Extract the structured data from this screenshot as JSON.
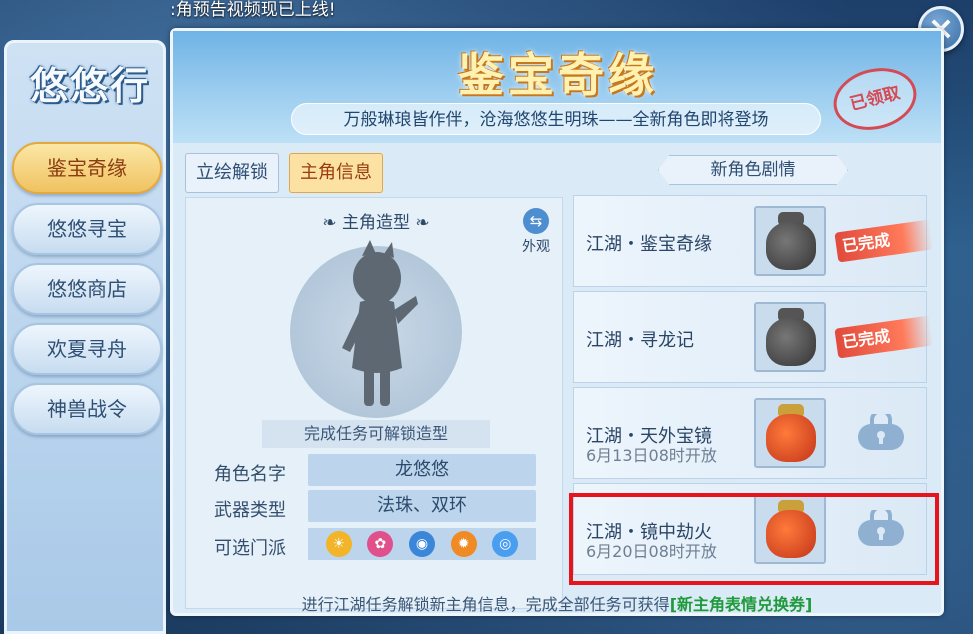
{
  "marquee": ":角预告视频现已上线!",
  "sidebar": {
    "title": "悠悠行",
    "items": [
      {
        "label": "鉴宝奇缘",
        "active": true
      },
      {
        "label": "悠悠寻宝",
        "active": false
      },
      {
        "label": "悠悠商店",
        "active": false
      },
      {
        "label": "欢夏寻舟",
        "active": false
      },
      {
        "label": "神兽战令",
        "active": false
      }
    ]
  },
  "banner": {
    "title": "鉴宝奇缘",
    "subtitle": "万般琳琅皆作伴，沧海悠悠生明珠——全新角色即将登场",
    "stamp": "已领取"
  },
  "tabs": [
    {
      "label": "立绘解锁",
      "active": false
    },
    {
      "label": "主角信息",
      "active": true
    }
  ],
  "character": {
    "heading": "主角造型",
    "outfit_label": "外观",
    "unlock_hint": "完成任务可解锁造型",
    "name_label": "角色名字",
    "name_value": "龙悠悠",
    "weapon_label": "武器类型",
    "weapon_value": "法珠、双环",
    "sect_label": "可选门派"
  },
  "story": {
    "header": "新角色剧情",
    "quests": [
      {
        "name": "江湖・鉴宝奇缘",
        "date": "",
        "status": "done",
        "status_label": "已完成",
        "bag": "gray"
      },
      {
        "name": "江湖・寻龙记",
        "date": "",
        "status": "done",
        "status_label": "已完成",
        "bag": "gray"
      },
      {
        "name": "江湖・天外宝镜",
        "date": "6月13日08时开放",
        "status": "locked",
        "status_label": "",
        "bag": "red"
      },
      {
        "name": "江湖・镜中劫火",
        "date": "6月20日08时开放",
        "status": "locked",
        "status_label": "",
        "bag": "red"
      }
    ]
  },
  "footer": {
    "text": "进行江湖任务解锁新主角信息，完成全部任务可获得",
    "highlight": "[新主角表情兑换券]"
  },
  "colors": {
    "highlight_border": "#e8141c",
    "active_tab": "#fbe2a3",
    "done_badge": "#e14a3c"
  }
}
